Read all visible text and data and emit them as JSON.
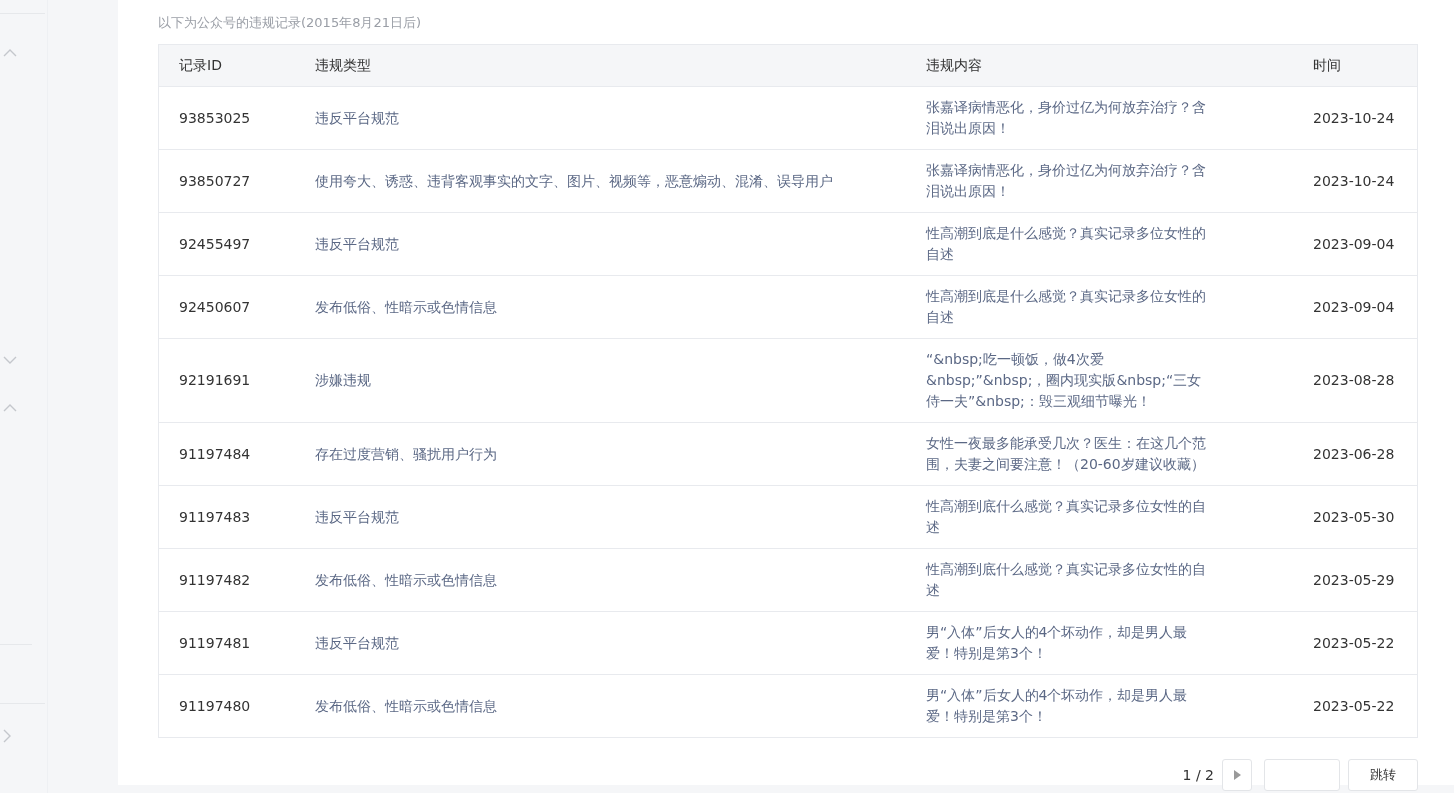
{
  "sidebar": {
    "sections": [
      {
        "kind": "group",
        "expanded": true
      },
      {
        "kind": "group",
        "expanded": false
      },
      {
        "kind": "group",
        "expanded": true
      },
      {
        "kind": "link"
      }
    ]
  },
  "caption": "以下为公众号的违规记录(2015年8月21日后)",
  "table": {
    "columns": [
      "记录ID",
      "违规类型",
      "违规内容",
      "时间"
    ],
    "rows": [
      [
        "93853025",
        "违反平台规范",
        "张嘉译病情恶化，身价过亿为何放弃治疗？含泪说出原因！",
        "2023-10-24"
      ],
      [
        "93850727",
        "使用夸大、诱惑、违背客观事实的文字、图片、视频等，恶意煽动、混淆、误导用户",
        "张嘉译病情恶化，身价过亿为何放弃治疗？含泪说出原因！",
        "2023-10-24"
      ],
      [
        "92455497",
        "违反平台规范",
        "性高潮到底是什么感觉？真实记录多位女性的自述",
        "2023-09-04"
      ],
      [
        "92450607",
        "发布低俗、性暗示或色情信息",
        "性高潮到底是什么感觉？真实记录多位女性的自述",
        "2023-09-04"
      ],
      [
        "92191691",
        "涉嫌违规",
        "“&nbsp;吃一顿饭，做4次爱&nbsp;”&nbsp;，圈内现实版&nbsp;“三女侍一夫”&nbsp;：毁三观细节曝光！",
        "2023-08-28"
      ],
      [
        "91197484",
        "存在过度营销、骚扰用户行为",
        "女性一夜最多能承受几次？医生：在这几个范围，夫妻之间要注意！（20-60岁建议收藏）",
        "2023-06-28"
      ],
      [
        "91197483",
        "违反平台规范",
        "性高潮到底什么感觉？真实记录多位女性的自述",
        "2023-05-30"
      ],
      [
        "91197482",
        "发布低俗、性暗示或色情信息",
        "性高潮到底什么感觉？真实记录多位女性的自述",
        "2023-05-29"
      ],
      [
        "91197481",
        "违反平台规范",
        "男“入体”后女人的4个坏动作，却是男人最爱！特别是第3个！",
        "2023-05-22"
      ],
      [
        "91197480",
        "发布低俗、性暗示或色情信息",
        "男“入体”后女人的4个坏动作，却是男人最爱！特别是第3个！",
        "2023-05-22"
      ]
    ]
  },
  "pagination": {
    "page_info": "1 / 2",
    "jump_button": "跳转"
  }
}
